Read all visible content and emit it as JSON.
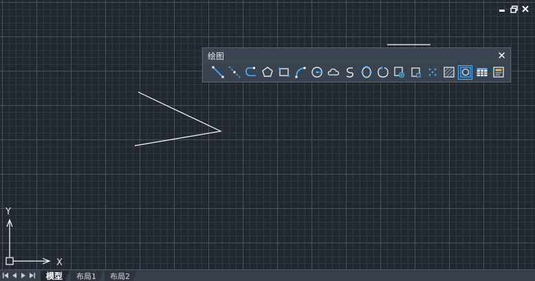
{
  "toolbar": {
    "title": "绘图",
    "close_label": "✕",
    "tools": [
      {
        "name": "line-tool",
        "icon": "line-icon"
      },
      {
        "name": "construction-line-tool",
        "icon": "construction-line-icon"
      },
      {
        "name": "polyline-tool",
        "icon": "polyline-icon"
      },
      {
        "name": "polygon-tool",
        "icon": "polygon-icon"
      },
      {
        "name": "rectangle-tool",
        "icon": "rectangle-icon"
      },
      {
        "name": "arc-tool",
        "icon": "arc-icon"
      },
      {
        "name": "circle-tool",
        "icon": "circle-icon"
      },
      {
        "name": "revision-cloud-tool",
        "icon": "cloud-icon"
      },
      {
        "name": "spline-tool",
        "icon": "spline-icon"
      },
      {
        "name": "ellipse-tool",
        "icon": "ellipse-icon"
      },
      {
        "name": "ellipse-arc-tool",
        "icon": "ellipse-arc-icon"
      },
      {
        "name": "insert-block-tool",
        "icon": "insert-block-icon"
      },
      {
        "name": "make-block-tool",
        "icon": "make-block-icon"
      },
      {
        "name": "point-tool",
        "icon": "point-icon"
      },
      {
        "name": "hatch-tool",
        "icon": "hatch-icon"
      },
      {
        "name": "region-tool",
        "icon": "region-icon"
      },
      {
        "name": "table-tool",
        "icon": "table-icon"
      },
      {
        "name": "multiline-text-tool",
        "icon": "mtext-icon"
      }
    ]
  },
  "ucs": {
    "x_label": "X",
    "y_label": "Y"
  },
  "tabs": [
    {
      "label": "模型",
      "active": true
    },
    {
      "label": "布局1",
      "active": false
    },
    {
      "label": "布局2",
      "active": false
    }
  ],
  "colors": {
    "canvas_background": "#212830",
    "grid_minor": "#373f49",
    "grid_major": "#5c6673",
    "tool_icon_accent": "#4fb0ff",
    "drawing_stroke": "#ffffff"
  }
}
